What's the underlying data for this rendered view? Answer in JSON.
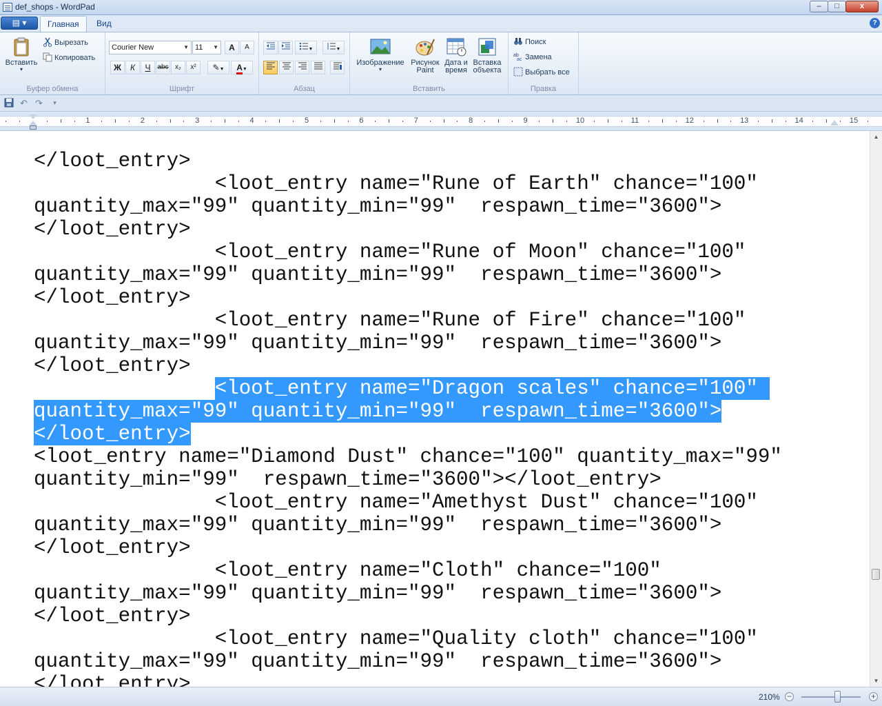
{
  "window": {
    "title": "def_shops - WordPad",
    "minimize": "–",
    "maximize": "□",
    "close": "x"
  },
  "tabs": {
    "app_menu": "▤ ▾",
    "home": "Главная",
    "view": "Вид",
    "help": "?"
  },
  "ribbon": {
    "clipboard": {
      "label": "Буфер обмена",
      "paste": "Вставить",
      "cut": "Вырезать",
      "copy": "Копировать"
    },
    "font": {
      "label": "Шрифт",
      "family": "Courier New",
      "size": "11",
      "grow": "A",
      "shrink": "A",
      "bold": "Ж",
      "italic": "К",
      "underline": "Ч",
      "strike": "abc",
      "subscript": "x₂",
      "superscript": "x²",
      "highlight": "✎",
      "color": "A"
    },
    "paragraph": {
      "label": "Абзац"
    },
    "insert": {
      "label": "Вставить",
      "picture": "Изображение",
      "paint_line1": "Рисунок",
      "paint_line2": "Paint",
      "datetime_line1": "Дата и",
      "datetime_line2": "время",
      "object_line1": "Вставка",
      "object_line2": "объекта"
    },
    "editing": {
      "label": "Правка",
      "find": "Поиск",
      "replace": "Замена",
      "select_all": "Выбрать все"
    }
  },
  "ruler": {
    "numbers": [
      "1",
      "2",
      "3",
      "4",
      "5",
      "6",
      "7",
      "8",
      "9",
      "10",
      "11",
      "12",
      "13",
      "14",
      "15"
    ]
  },
  "document": {
    "lines": [
      {
        "pre": "</loot_entry>",
        "sel": "",
        "post": ""
      },
      {
        "pre": "               <loot_entry name=\"Rune of Earth\" chance=\"100\"",
        "sel": "",
        "post": ""
      },
      {
        "pre": "quantity_max=\"99\" quantity_min=\"99\"  respawn_time=\"3600\">",
        "sel": "",
        "post": ""
      },
      {
        "pre": "</loot_entry>",
        "sel": "",
        "post": ""
      },
      {
        "pre": "               <loot_entry name=\"Rune of Moon\" chance=\"100\"",
        "sel": "",
        "post": ""
      },
      {
        "pre": "quantity_max=\"99\" quantity_min=\"99\"  respawn_time=\"3600\">",
        "sel": "",
        "post": ""
      },
      {
        "pre": "</loot_entry>",
        "sel": "",
        "post": ""
      },
      {
        "pre": "               <loot_entry name=\"Rune of Fire\" chance=\"100\"",
        "sel": "",
        "post": ""
      },
      {
        "pre": "quantity_max=\"99\" quantity_min=\"99\"  respawn_time=\"3600\">",
        "sel": "",
        "post": ""
      },
      {
        "pre": "</loot_entry>",
        "sel": "",
        "post": ""
      },
      {
        "pre": "               ",
        "sel": "<loot_entry name=\"Dragon scales\" chance=\"100\" ",
        "post": ""
      },
      {
        "pre": "",
        "sel": "quantity_max=\"99\" quantity_min=\"99\"  respawn_time=\"3600\">",
        "post": ""
      },
      {
        "pre": "",
        "sel": "</loot_entry>",
        "post": ""
      },
      {
        "pre": "<loot_entry name=\"Diamond Dust\" chance=\"100\" quantity_max=\"99\"",
        "sel": "",
        "post": ""
      },
      {
        "pre": "quantity_min=\"99\"  respawn_time=\"3600\"></loot_entry>",
        "sel": "",
        "post": ""
      },
      {
        "pre": "               <loot_entry name=\"Amethyst Dust\" chance=\"100\"",
        "sel": "",
        "post": ""
      },
      {
        "pre": "quantity_max=\"99\" quantity_min=\"99\"  respawn_time=\"3600\">",
        "sel": "",
        "post": ""
      },
      {
        "pre": "</loot_entry>",
        "sel": "",
        "post": ""
      },
      {
        "pre": "               <loot_entry name=\"Cloth\" chance=\"100\"",
        "sel": "",
        "post": ""
      },
      {
        "pre": "quantity_max=\"99\" quantity_min=\"99\"  respawn_time=\"3600\">",
        "sel": "",
        "post": ""
      },
      {
        "pre": "</loot_entry>",
        "sel": "",
        "post": ""
      },
      {
        "pre": "               <loot_entry name=\"Quality cloth\" chance=\"100\"",
        "sel": "",
        "post": ""
      },
      {
        "pre": "quantity_max=\"99\" quantity_min=\"99\"  respawn_time=\"3600\">",
        "sel": "",
        "post": ""
      },
      {
        "pre": "</loot_entry>",
        "sel": "",
        "post": ""
      }
    ]
  },
  "status": {
    "zoom": "210%",
    "zoom_out": "−",
    "zoom_in": "+"
  },
  "colors": {
    "selection": "#3399ff",
    "ribbon_bg": "#dde8f5"
  }
}
